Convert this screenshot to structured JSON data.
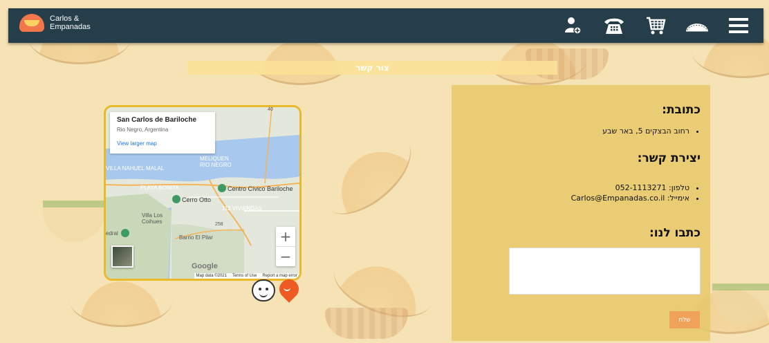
{
  "brand": {
    "line1": "Carlos &",
    "line2": "Empanadas"
  },
  "nav": {
    "icons": [
      "user-add-icon",
      "phone-icon",
      "cart-icon",
      "empanada-icon",
      "menu-icon"
    ]
  },
  "page": {
    "title": "צור קשר"
  },
  "map": {
    "place_name": "San Carlos de Bariloche",
    "region": "Rio Negro, Argentina",
    "view_larger": "View larger map",
    "labels": {
      "centro_civico": "Centro Cívico Bariloche",
      "cerro_otto": "Cerro Otto",
      "villa_los_coihues": "Villa Los Coihues",
      "barrio_el_pilar": "Barrio El Pilar",
      "villa_nahuel_malal": "VILLA NAHUEL MALAL",
      "playa_bonita": "PLAYA BONITA",
      "melipal": "MELIQUEN RIO NEGRO",
      "viviendas": "112 VIVIENDAS",
      "edral": "edral"
    },
    "route_40": "40",
    "route_258": "258",
    "zoom_in": "+",
    "zoom_out": "−",
    "google": "Google",
    "footer": {
      "data": "Map data ©2021",
      "terms": "Terms of Use",
      "report": "Report a map error"
    }
  },
  "contact": {
    "address_heading": "כתובת:",
    "address": "רחוב הבצקים 5, באר שבע",
    "contact_heading": "יצירת קשר:",
    "phone": "טלפון: 052-1113271",
    "email": "אימייל: Carlos@Empanadas.co.il",
    "write_heading": "כתבו לנו:",
    "message_value": "",
    "send_label": "שלח"
  },
  "colors": {
    "navbar": "#263e4a",
    "background": "#f6e3b5",
    "panel": "#e8c869",
    "map_border": "#e8b928",
    "send_button": "#f0a25a",
    "pin": "#ee5a24"
  }
}
